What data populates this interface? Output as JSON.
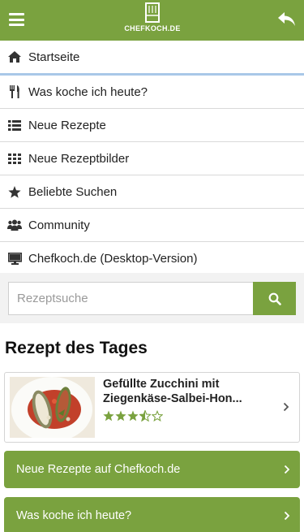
{
  "header": {
    "logo_text": "CHEFKOCH.DE",
    "accent_color": "#7aa23f"
  },
  "menu": {
    "items": [
      {
        "label": "Startseite",
        "icon": "home-icon",
        "active": true
      },
      {
        "label": "Was koche ich heute?",
        "icon": "fork-knife-icon"
      },
      {
        "label": "Neue Rezepte",
        "icon": "list-icon"
      },
      {
        "label": "Neue Rezeptbilder",
        "icon": "grid-icon"
      },
      {
        "label": "Beliebte Suchen",
        "icon": "star-icon"
      },
      {
        "label": "Community",
        "icon": "users-icon"
      },
      {
        "label": "Chefkoch.de (Desktop-Version)",
        "icon": "desktop-icon"
      }
    ]
  },
  "search": {
    "placeholder": "Rezeptsuche",
    "value": ""
  },
  "recipe_of_day": {
    "section_title": "Rezept des Tages",
    "title": "Gefüllte Zucchini mit\nZiegenkäse-Salbei-Hon...",
    "rating": 3.5,
    "max_rating": 5
  },
  "buttons": {
    "new_recipes": "Neue Rezepte auf Chefkoch.de",
    "what_to_cook": "Was koche ich heute?"
  }
}
